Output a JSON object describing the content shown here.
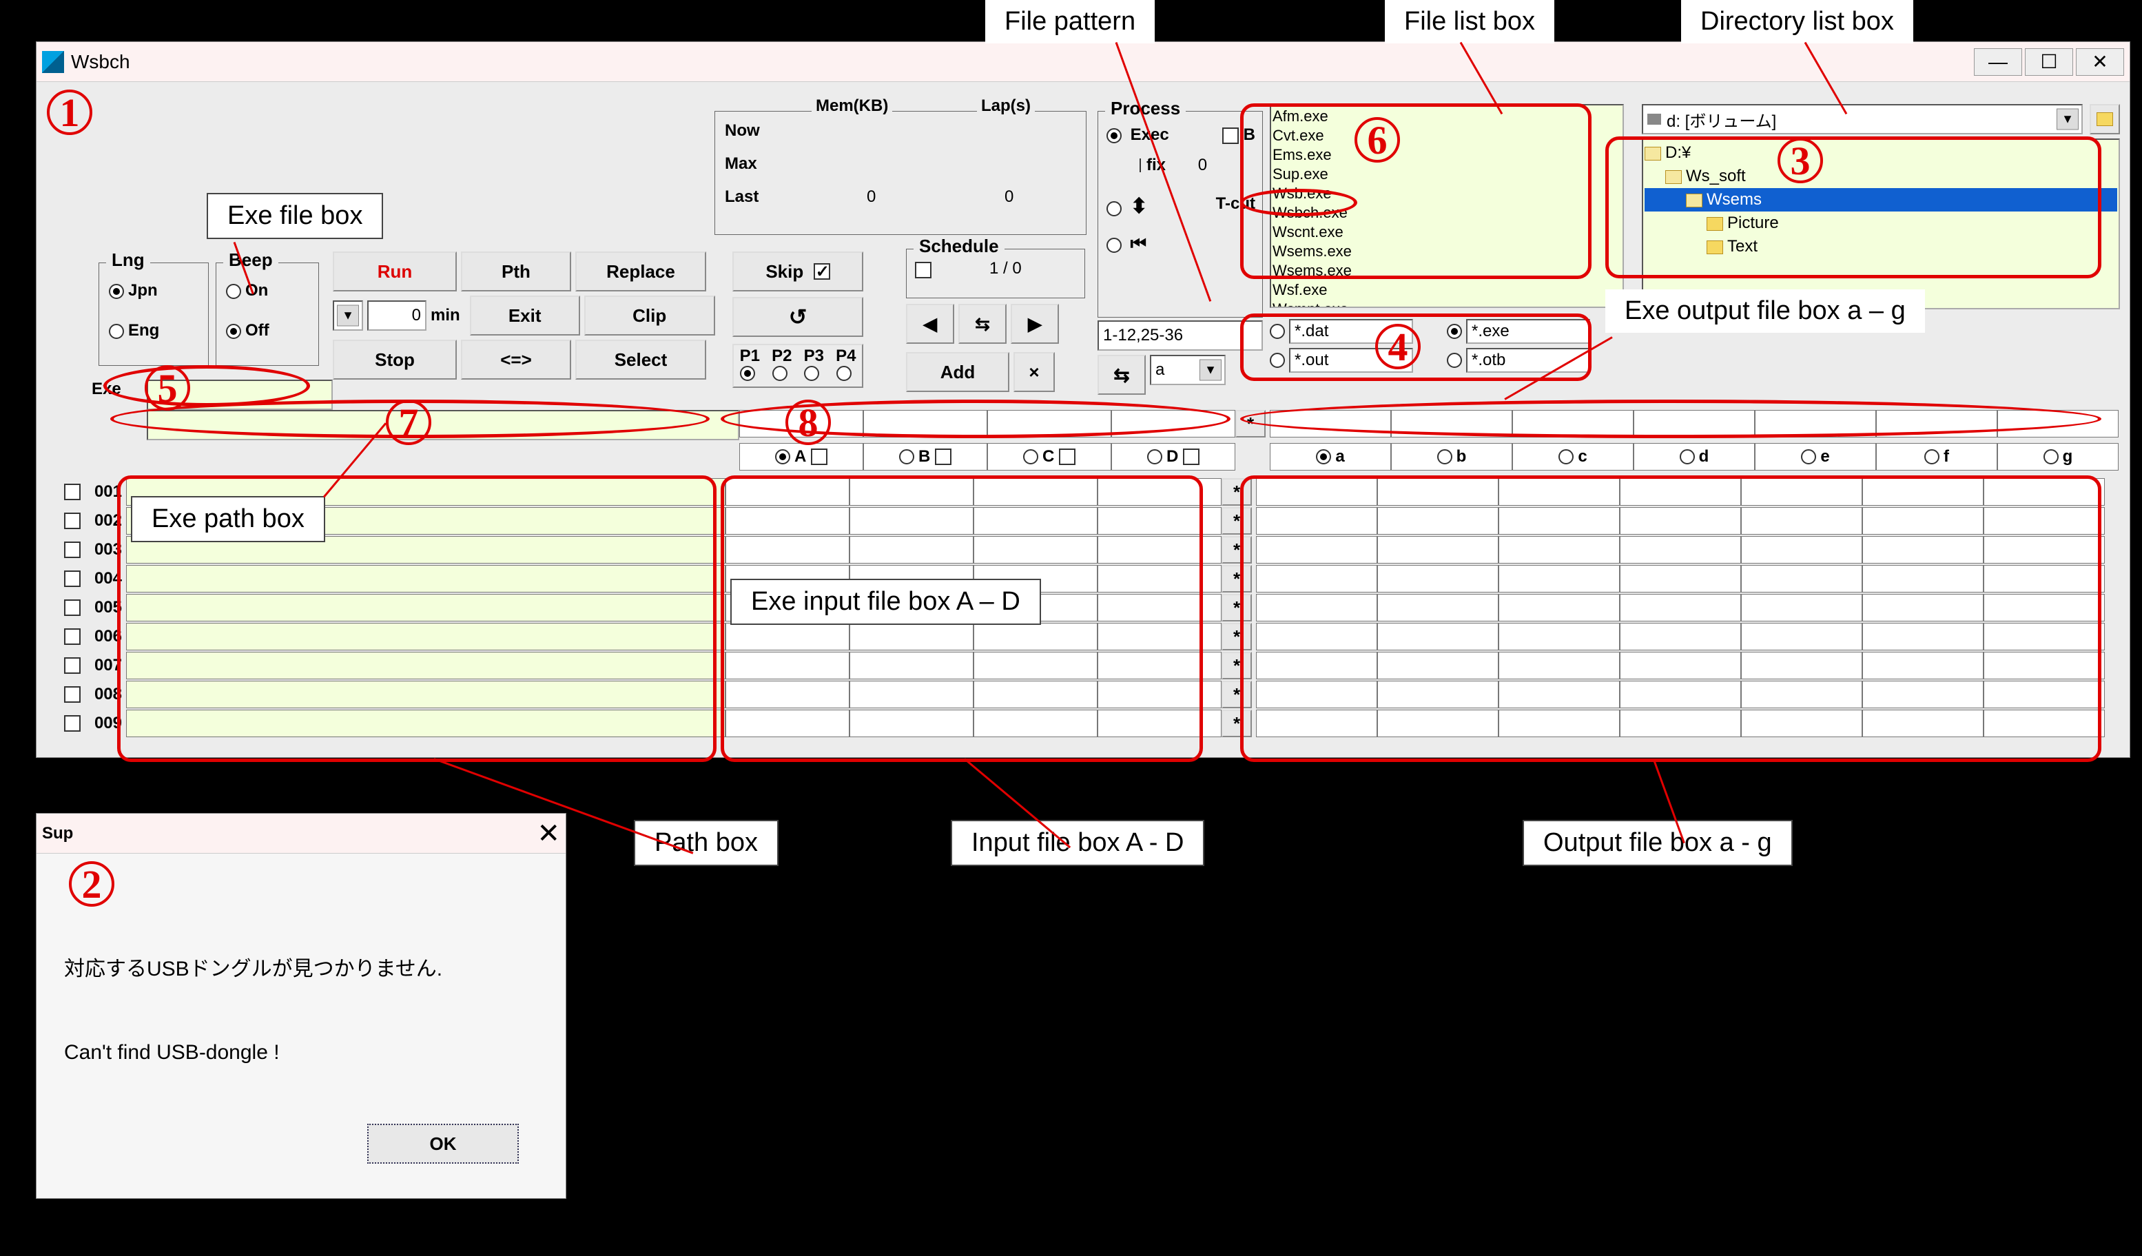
{
  "window": {
    "title": "Wsbch"
  },
  "panels": {
    "mem_label": "Mem(KB)",
    "lap_label": "Lap(s)",
    "mem_now": "Now",
    "mem_max": "Max",
    "mem_last": "Last",
    "mem_last_v": "0",
    "lap_last_v": "0",
    "process_label": "Process",
    "exec_label": "Exec",
    "b_label": "B",
    "fix_label": "fix",
    "fix_val": "0",
    "tcut_label": "T-cut",
    "schedule_label": "Schedule",
    "sched_sep": "/",
    "sched_a": "1",
    "sched_b": "0"
  },
  "lng": {
    "label": "Lng",
    "jpn": "Jpn",
    "eng": "Eng"
  },
  "beep": {
    "label": "Beep",
    "on": "On",
    "off": "Off"
  },
  "buttons": {
    "run": "Run",
    "pth": "Pth",
    "replace": "Replace",
    "exit": "Exit",
    "clip": "Clip",
    "stop": "Stop",
    "swap": "<=>",
    "select": "Select",
    "skip": "Skip",
    "add": "Add",
    "x": "×",
    "min_val": "0",
    "min_unit": "min",
    "p1": "P1",
    "p2": "P2",
    "p3": "P3",
    "p4": "P4",
    "reload": "↺",
    "prev": "◀",
    "next": "▶",
    "step": "⇆"
  },
  "exe_label": "Exe",
  "exec_range": "1-12,25-36",
  "swap2": "⇆",
  "a_sel": "a",
  "star": "*",
  "patterns": {
    "dat": "*.dat",
    "exe": "*.exe",
    "out": "*.out",
    "otb": "*.otb"
  },
  "filelist": [
    "Afm.exe",
    "Cvt.exe",
    "Ems.exe",
    "Sup.exe",
    "Wsb.exe",
    "Wsbch.exe",
    "Wscnt.exe",
    "Wsems.exe",
    "Wsems.exe",
    "Wsf.exe",
    "Wsmnt.exe"
  ],
  "drive": "d: [ボリューム]",
  "dirtree": {
    "root": "D:¥",
    "n1": "Ws_soft",
    "n2": "Wsems",
    "n3": "Picture",
    "n4": "Text"
  },
  "cols_in": {
    "A": "A",
    "B": "B",
    "C": "C",
    "D": "D"
  },
  "cols_out": {
    "a": "a",
    "b": "b",
    "c": "c",
    "d": "d",
    "e": "e",
    "f": "f",
    "g": "g"
  },
  "rows": [
    "001",
    "002",
    "003",
    "004",
    "005",
    "006",
    "007",
    "008",
    "009"
  ],
  "dialog": {
    "title": "Sup",
    "msg_jp": "対応するUSBドングルが見つかりません.",
    "msg_en": "Can't find USB-dongle !",
    "ok": "OK"
  },
  "ann": {
    "file_pattern": "File pattern",
    "file_list": "File list box",
    "dir_list": "Directory list box",
    "exe_file_box": "Exe file box",
    "exe_path_box": "Exe path box",
    "exe_input": "Exe input file box A – D",
    "exe_output": "Exe output file box a – g",
    "path_box": "Path box",
    "input_box": "Input file box A - D",
    "output_box": "Output file box a - g"
  }
}
